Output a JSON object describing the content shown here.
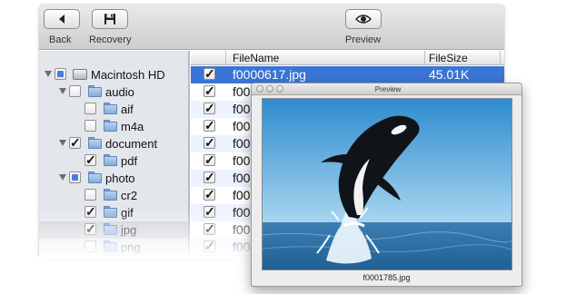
{
  "toolbar": {
    "back_label": "Back",
    "recovery_label": "Recovery",
    "preview_label": "Preview"
  },
  "sidebar": {
    "items": [
      {
        "label": "Macintosh HD",
        "check": "mixed",
        "expanded": true,
        "icon": "disk-icon"
      },
      {
        "label": "audio",
        "check": "none",
        "expanded": true,
        "icon": "folder-icon"
      },
      {
        "label": "aif",
        "check": "none",
        "expanded": false,
        "icon": "folder-icon"
      },
      {
        "label": "m4a",
        "check": "none",
        "expanded": false,
        "icon": "folder-icon"
      },
      {
        "label": "document",
        "check": "checked",
        "expanded": true,
        "icon": "folder-icon"
      },
      {
        "label": "pdf",
        "check": "checked",
        "expanded": false,
        "icon": "folder-icon"
      },
      {
        "label": "photo",
        "check": "mixed",
        "expanded": true,
        "icon": "folder-icon"
      },
      {
        "label": "cr2",
        "check": "none",
        "expanded": false,
        "icon": "folder-icon"
      },
      {
        "label": "gif",
        "check": "checked",
        "expanded": false,
        "icon": "folder-icon"
      },
      {
        "label": "jpg",
        "check": "checked",
        "expanded": false,
        "icon": "folder-icon",
        "selected": true
      },
      {
        "label": "png",
        "check": "none",
        "expanded": false,
        "icon": "folder-icon"
      }
    ]
  },
  "list": {
    "columns": {
      "name": "FileName",
      "size": "FileSize"
    },
    "rows": [
      {
        "name": "f0000617.jpg",
        "size": "45.01K",
        "checked": true
      },
      {
        "name": "f00",
        "size": "",
        "checked": true
      },
      {
        "name": "f00",
        "size": "",
        "checked": true
      },
      {
        "name": "f00",
        "size": "",
        "checked": true
      },
      {
        "name": "f00",
        "size": "",
        "checked": true
      },
      {
        "name": "f00",
        "size": "",
        "checked": true
      },
      {
        "name": "f00",
        "size": "",
        "checked": true
      },
      {
        "name": "f00",
        "size": "",
        "checked": true
      },
      {
        "name": "f00",
        "size": "",
        "checked": true
      },
      {
        "name": "f00",
        "size": "",
        "checked": true
      },
      {
        "name": "f00",
        "size": "",
        "checked": true
      }
    ]
  },
  "preview": {
    "title": "Preview",
    "caption": "f0001785.jpg"
  },
  "colors": {
    "selection": "#3a75d6",
    "sidebar_bg": "#e3e7ec",
    "sky": "#4aa0d8",
    "sea": "#2d74ad"
  }
}
